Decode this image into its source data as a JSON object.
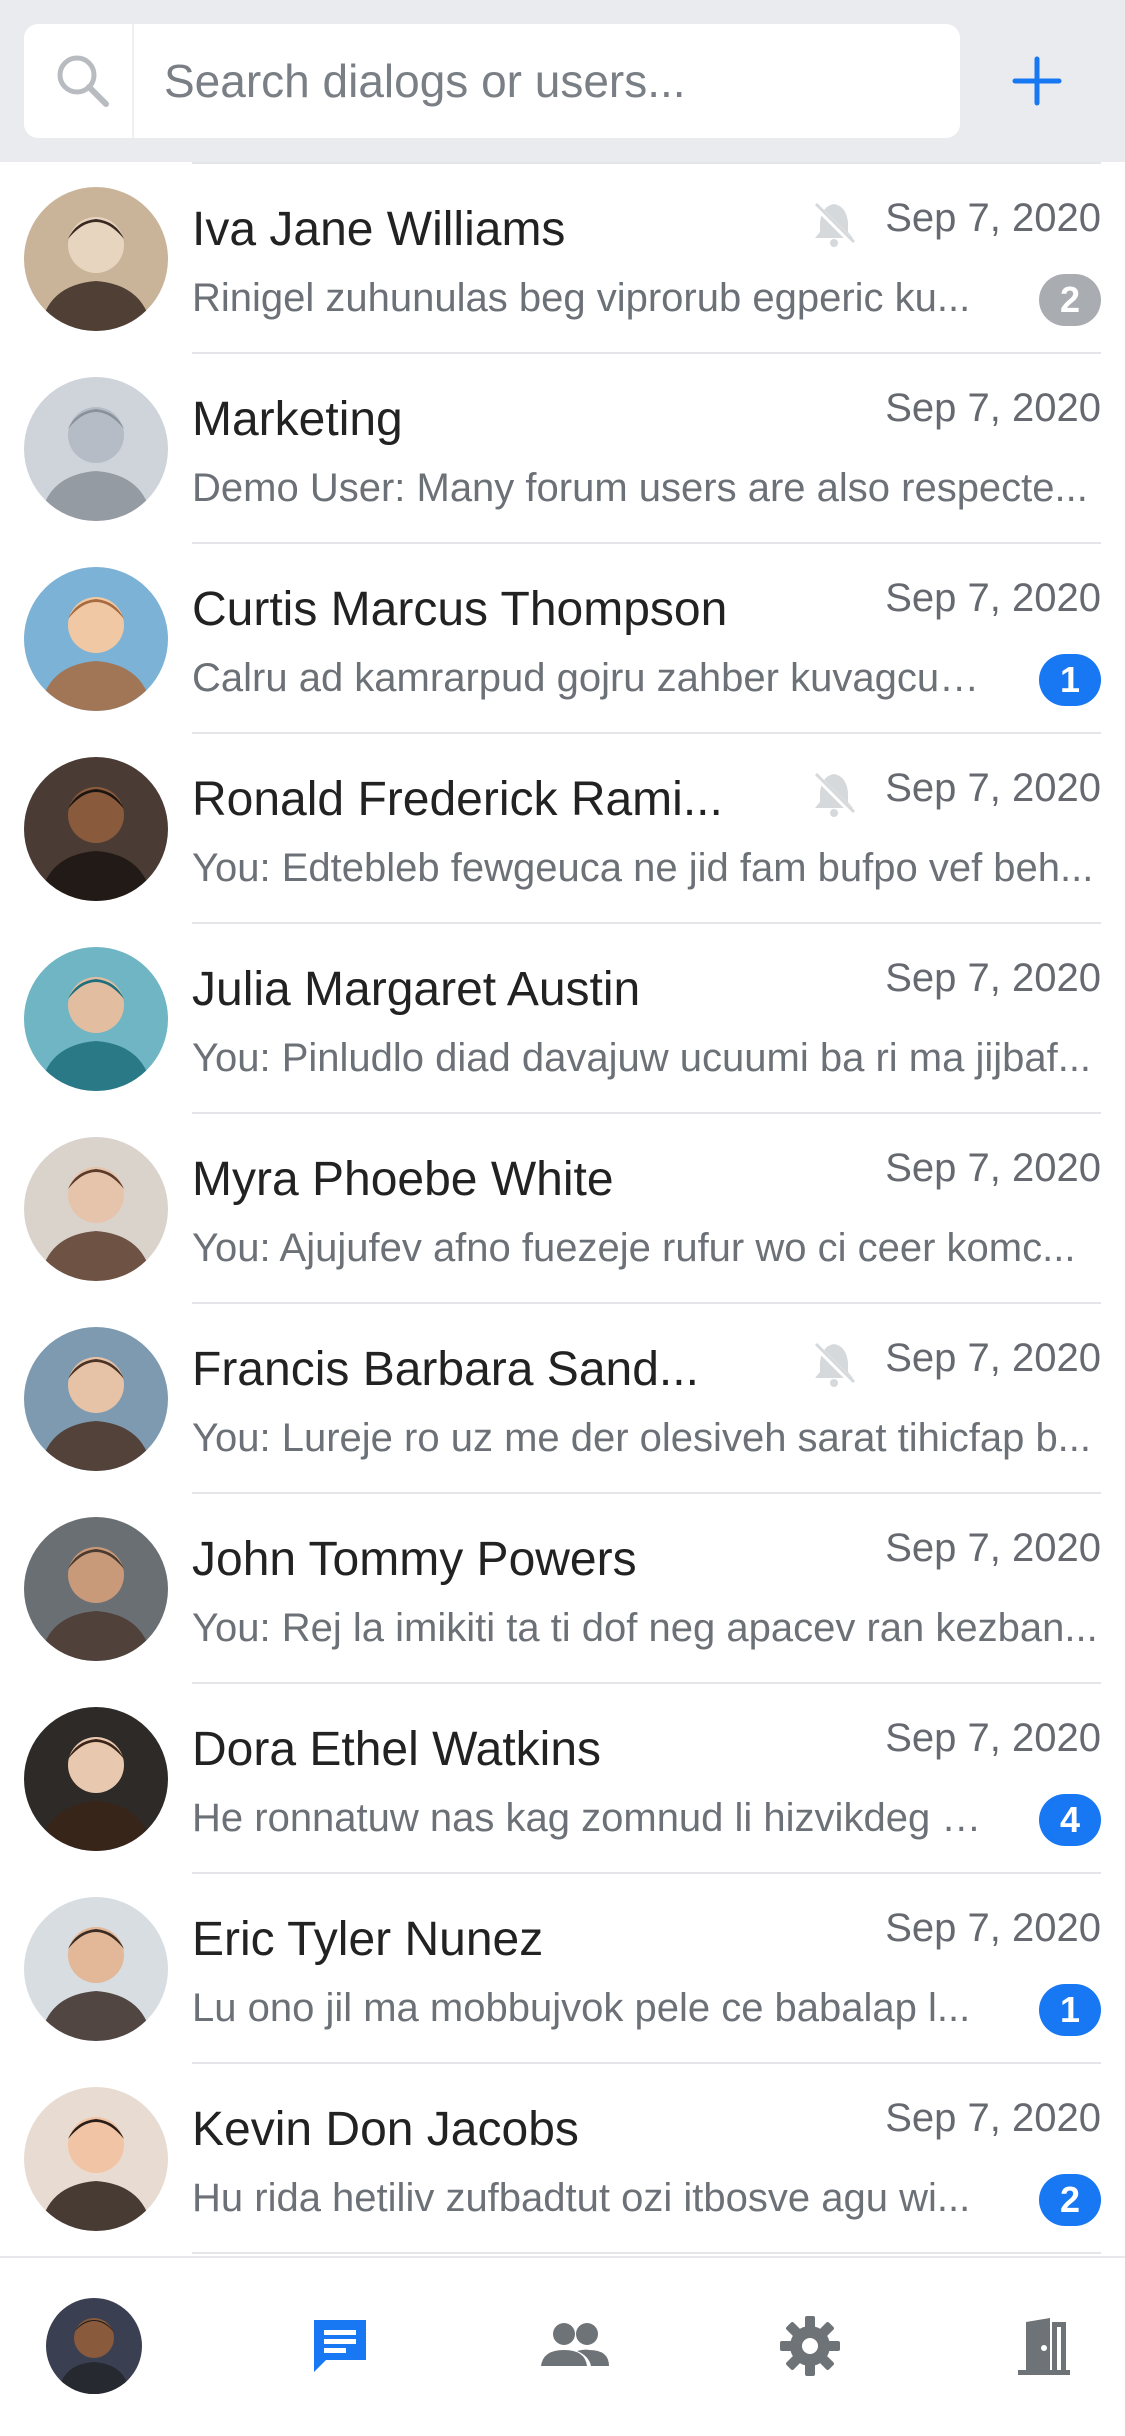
{
  "search": {
    "placeholder": "Search dialogs or users..."
  },
  "colors": {
    "accent": "#1877f2",
    "muted_badge": "#a9adb2",
    "header_bg": "#e9ebee"
  },
  "dialogs": [
    {
      "name": "Iva Jane Williams",
      "date": "Sep 7, 2020",
      "preview": "Rinigel zuhunulas beg viprorub egperic ku...",
      "muted": true,
      "badge": "2",
      "badge_muted": true,
      "avatar_icon": "user-photo"
    },
    {
      "name": "Marketing",
      "date": "Sep 7, 2020",
      "preview": "Demo User: Many forum users are also respecte...",
      "muted": false,
      "badge": "",
      "badge_muted": false,
      "avatar_icon": "group-photo"
    },
    {
      "name": "Curtis Marcus Thompson",
      "date": "Sep 7, 2020",
      "preview": "Calru ad kamrarpud gojru zahber kuvagcu ...",
      "muted": false,
      "badge": "1",
      "badge_muted": false,
      "avatar_icon": "user-photo"
    },
    {
      "name": "Ronald Frederick Rami...",
      "date": "Sep 7, 2020",
      "preview": "You: Edtebleb fewgeuca ne jid fam bufpo vef beh...",
      "muted": true,
      "badge": "",
      "badge_muted": false,
      "avatar_icon": "user-photo"
    },
    {
      "name": "Julia Margaret Austin",
      "date": "Sep 7, 2020",
      "preview": "You: Pinludlo diad davajuw ucuumi ba ri ma jijbaf...",
      "muted": false,
      "badge": "",
      "badge_muted": false,
      "avatar_icon": "user-photo"
    },
    {
      "name": "Myra Phoebe White",
      "date": "Sep 7, 2020",
      "preview": "You: Ajujufev afno fuezeje rufur wo ci ceer komc...",
      "muted": false,
      "badge": "",
      "badge_muted": false,
      "avatar_icon": "user-photo"
    },
    {
      "name": "Francis Barbara Sand...",
      "date": "Sep 7, 2020",
      "preview": "You: Lureje ro uz me der olesiveh sarat tihicfap b...",
      "muted": true,
      "badge": "",
      "badge_muted": false,
      "avatar_icon": "user-photo"
    },
    {
      "name": "John Tommy Powers",
      "date": "Sep 7, 2020",
      "preview": "You: Rej la imikiti ta ti dof neg apacev ran kezban...",
      "muted": false,
      "badge": "",
      "badge_muted": false,
      "avatar_icon": "user-photo"
    },
    {
      "name": "Dora Ethel Watkins",
      "date": "Sep 7, 2020",
      "preview": "He ronnatuw nas kag zomnud li hizvikdeg j...",
      "muted": false,
      "badge": "4",
      "badge_muted": false,
      "avatar_icon": "user-photo"
    },
    {
      "name": "Eric Tyler Nunez",
      "date": "Sep 7, 2020",
      "preview": "Lu ono jil ma mobbujvok pele ce babalap l...",
      "muted": false,
      "badge": "1",
      "badge_muted": false,
      "avatar_icon": "user-photo"
    },
    {
      "name": "Kevin Don Jacobs",
      "date": "Sep 7, 2020",
      "preview": "Hu rida hetiliv zufbadtut ozi itbosve agu wi...",
      "muted": false,
      "badge": "2",
      "badge_muted": false,
      "avatar_icon": "user-photo"
    }
  ],
  "bottom_nav": {
    "items": [
      {
        "icon": "profile-avatar",
        "active": false
      },
      {
        "icon": "chat-icon",
        "active": true
      },
      {
        "icon": "contacts-icon",
        "active": false
      },
      {
        "icon": "settings-icon",
        "active": false
      },
      {
        "icon": "logout-door-icon",
        "active": false
      }
    ]
  }
}
